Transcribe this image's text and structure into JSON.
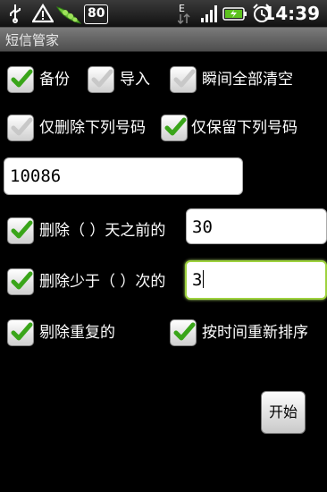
{
  "status_bar": {
    "time": "14:39",
    "notification_count": "80",
    "icons": [
      "usb-icon",
      "warning-icon",
      "pea-pod-icon",
      "notification-count-badge",
      "data-transfer-icon",
      "signal-icon",
      "battery-icon",
      "alarm-icon"
    ]
  },
  "app": {
    "title": "短信管家"
  },
  "options": {
    "backup": {
      "label": "备份",
      "checked": true
    },
    "import": {
      "label": "导入",
      "checked": false
    },
    "clear_all": {
      "label": "瞬间全部清空",
      "checked": false
    },
    "delete_only": {
      "label": "仅删除下列号码",
      "checked": false
    },
    "keep_only": {
      "label": "仅保留下列号码",
      "checked": true
    },
    "delete_days": {
      "label": "删除（ ）天之前的",
      "checked": true
    },
    "delete_fewer": {
      "label": "删除少于（ ）次的",
      "checked": true
    },
    "remove_dup": {
      "label": "剔除重复的",
      "checked": true
    },
    "resort_time": {
      "label": "按时间重新排序",
      "checked": true
    }
  },
  "inputs": {
    "number": "10086",
    "days": "30",
    "count": "3"
  },
  "buttons": {
    "start": "开始"
  },
  "colors": {
    "check_green": "#3aa51a",
    "check_gray": "#c8c8c8",
    "focus_border": "#9ed23e"
  }
}
